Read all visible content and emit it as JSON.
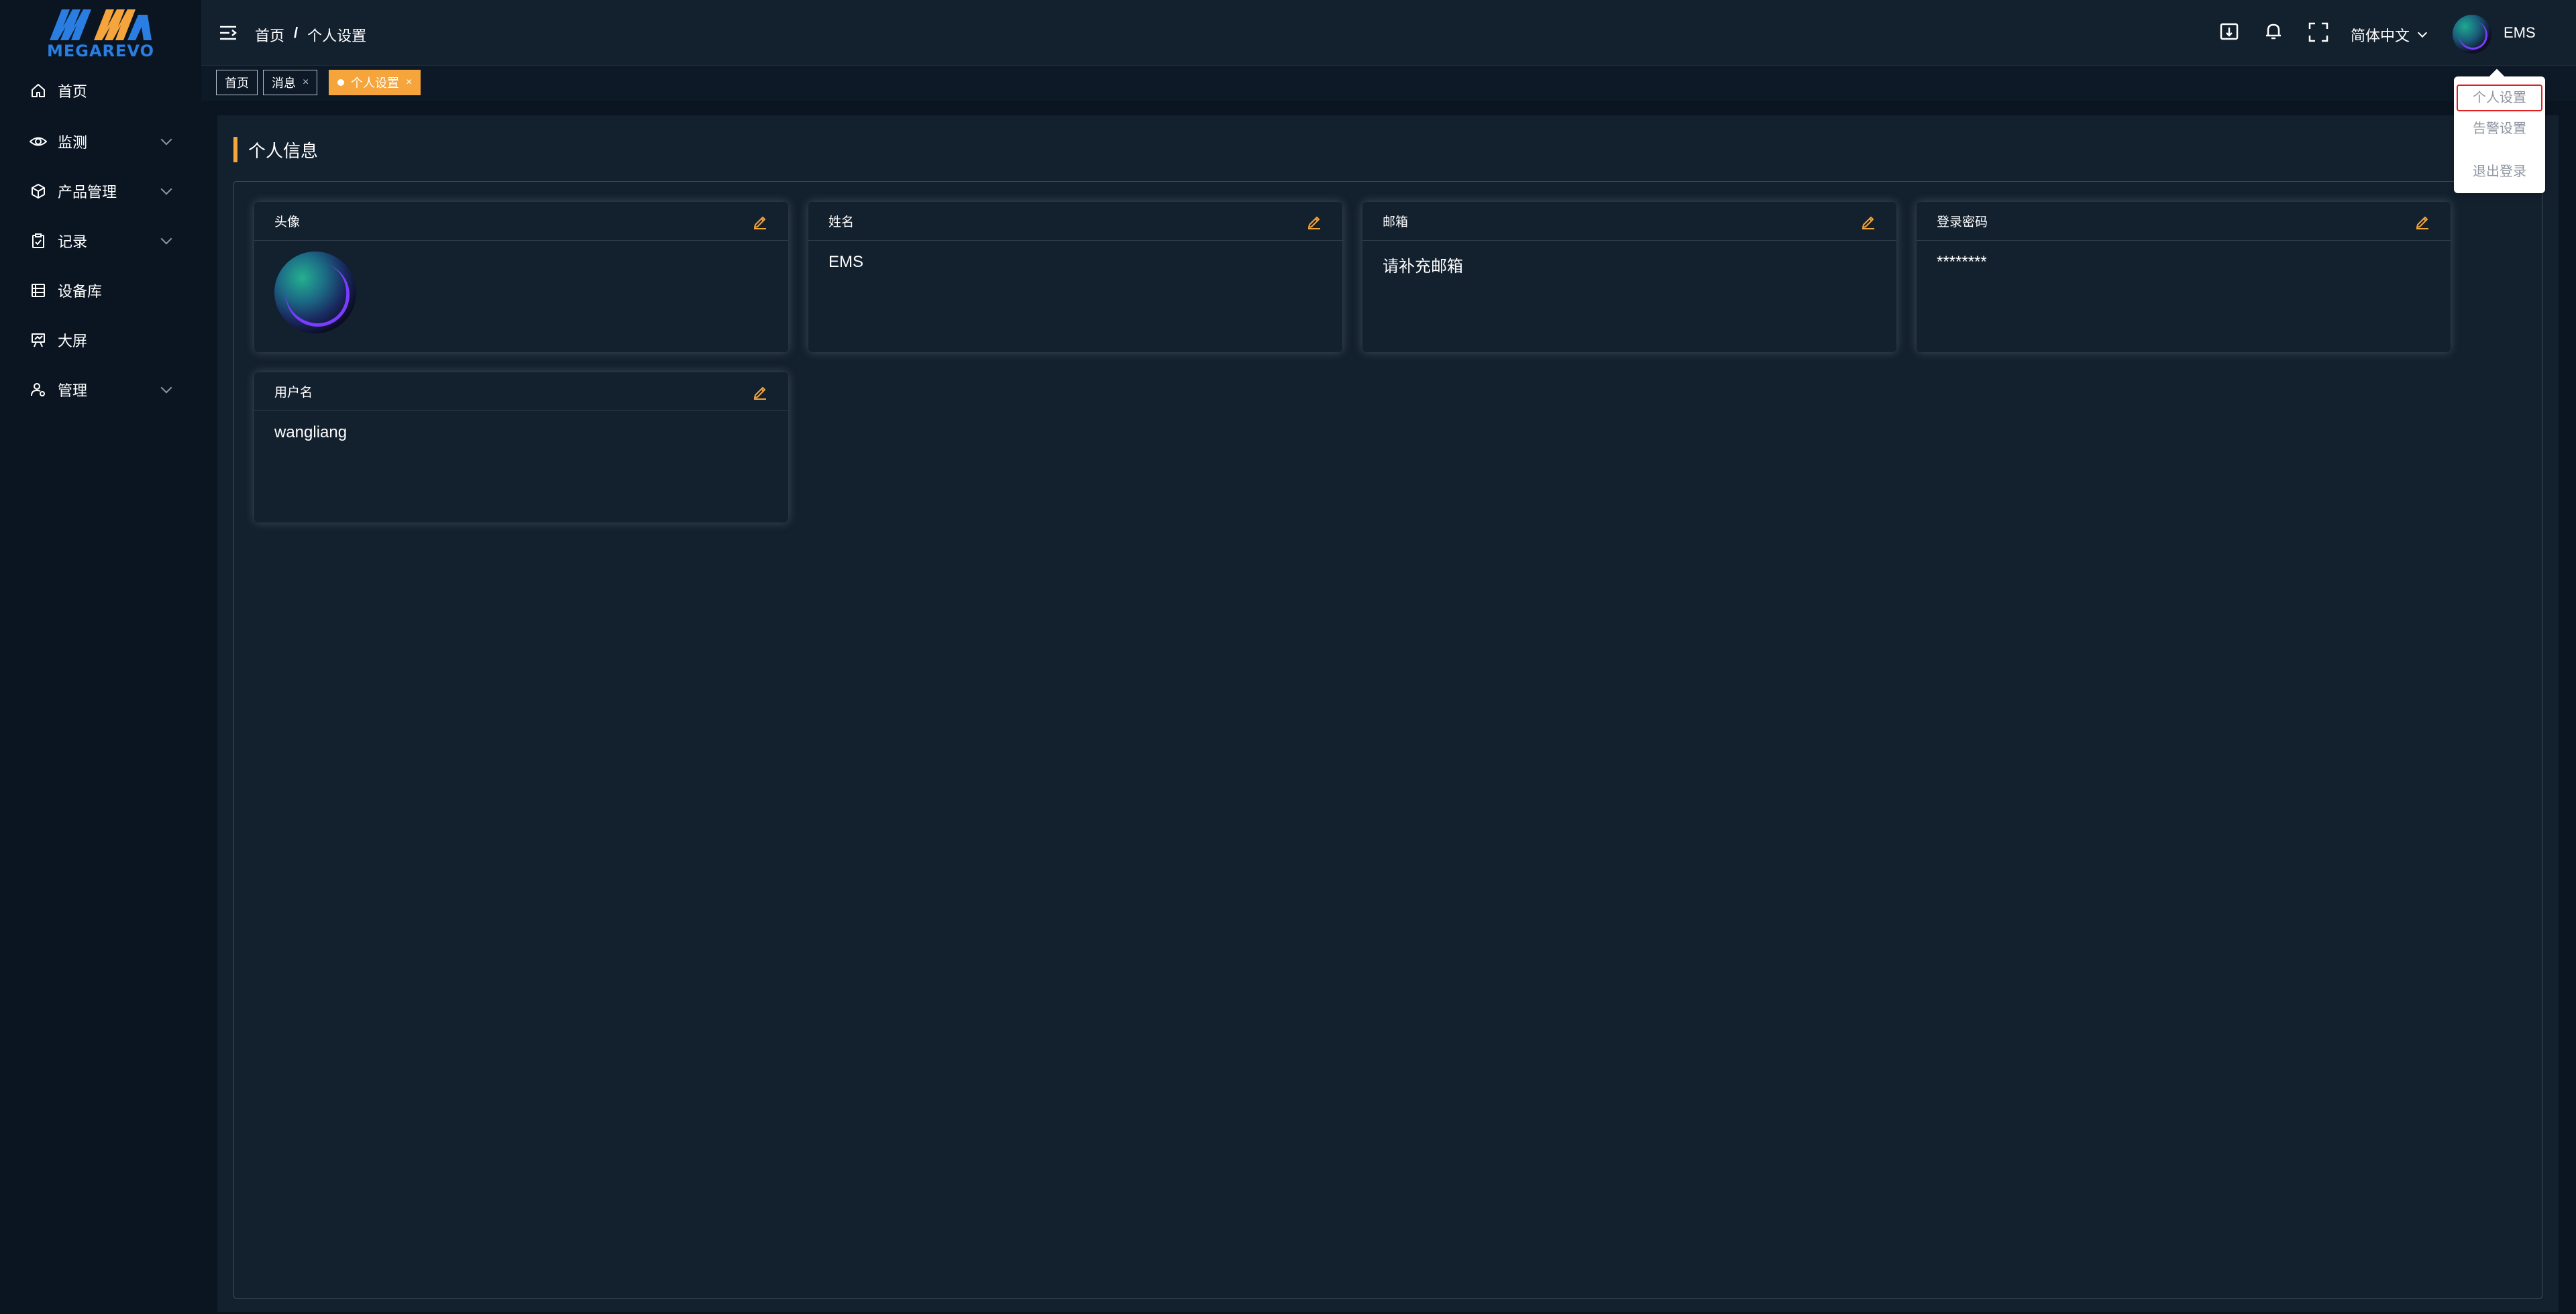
{
  "app": {
    "logo_text": "MEGAREVO",
    "brand_color": "#2a7de1",
    "accent_color": "#f5a53b"
  },
  "sidebar": {
    "items": [
      {
        "label": "首页",
        "icon": "home-icon",
        "has_submenu": false
      },
      {
        "label": "监测",
        "icon": "eye-icon",
        "has_submenu": true
      },
      {
        "label": "产品管理",
        "icon": "cube-icon",
        "has_submenu": true
      },
      {
        "label": "记录",
        "icon": "clipboard-check-icon",
        "has_submenu": true
      },
      {
        "label": "设备库",
        "icon": "database-icon",
        "has_submenu": false
      },
      {
        "label": "大屏",
        "icon": "presentation-icon",
        "has_submenu": false
      },
      {
        "label": "管理",
        "icon": "user-gear-icon",
        "has_submenu": true
      }
    ]
  },
  "header": {
    "breadcrumb": [
      "首页",
      "个人设置"
    ],
    "breadcrumb_sep": "/",
    "language": "简体中文",
    "user_name": "EMS"
  },
  "tabs": [
    {
      "label": "首页",
      "closable": false,
      "active": false
    },
    {
      "label": "消息",
      "closable": true,
      "active": false
    },
    {
      "label": "个人设置",
      "closable": true,
      "active": true
    }
  ],
  "tab_close_glyph": "×",
  "main": {
    "section_title": "个人信息",
    "cards": [
      {
        "title": "头像",
        "value": ""
      },
      {
        "title": "姓名",
        "value": "EMS"
      },
      {
        "title": "邮箱",
        "value": "请补充邮箱"
      },
      {
        "title": "登录密码",
        "value": "********"
      },
      {
        "title": "用户名",
        "value": "wangliang"
      }
    ]
  },
  "user_menu": {
    "items": [
      "个人设置",
      "告警设置",
      "退出登录"
    ]
  }
}
